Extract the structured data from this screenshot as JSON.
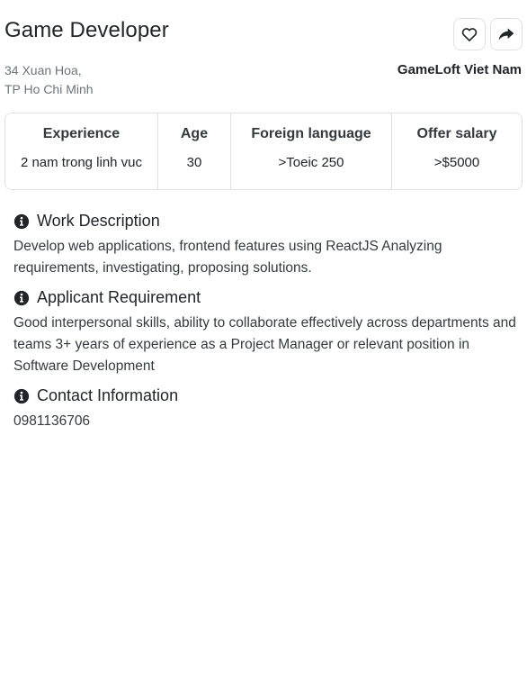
{
  "job": {
    "title": "Game Developer",
    "address_line1": "34 Xuan Hoa,",
    "address_line2": "TP Ho Chi Minh",
    "company": "GameLoft Viet Nam"
  },
  "actions": {
    "favorite_icon": "heart-icon",
    "share_icon": "share-arrow-icon"
  },
  "info_table": {
    "headers": [
      "Experience",
      "Age",
      "Foreign language",
      "Offer salary"
    ],
    "values": [
      "2 nam trong linh vuc",
      "30",
      ">Toeic 250",
      ">$5000"
    ]
  },
  "sections": [
    {
      "title": "Work Description",
      "body": "Develop web applications, frontend features using ReactJS Analyzing requirements, investigating, proposing solutions."
    },
    {
      "title": "Applicant Requirement",
      "body": "Good interpersonal skills, ability to collaborate effectively across departments and teams 3+ years of experience as a Project Manager or relevant position in Software Development"
    },
    {
      "title": "Contact Information",
      "body": "0981136706"
    }
  ],
  "colors": {
    "text": "#212529",
    "muted": "#6c757d",
    "border": "#dee2e6"
  }
}
